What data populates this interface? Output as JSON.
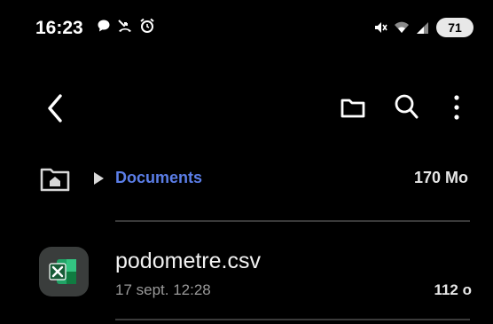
{
  "status_bar": {
    "time": "16:23",
    "battery": "71",
    "left_icons": [
      "chat-bubble-icon",
      "missed-call-icon",
      "alarm-icon"
    ],
    "right_icons": [
      "mute-icon",
      "wifi-icon",
      "signal-icon"
    ]
  },
  "app_bar": {
    "icons": [
      "back-arrow-icon",
      "new-folder-icon",
      "search-icon",
      "more-vert-icon"
    ]
  },
  "breadcrumb": {
    "current": "Documents",
    "storage_size": "170 Mo"
  },
  "files": [
    {
      "name": "podometre.csv",
      "date": "17 sept. 12:28",
      "size": "112 o",
      "icon": "excel-file-icon"
    }
  ],
  "colors": {
    "background": "#000000",
    "accent": "#5b7ee8",
    "excel_green": "#21a366"
  }
}
